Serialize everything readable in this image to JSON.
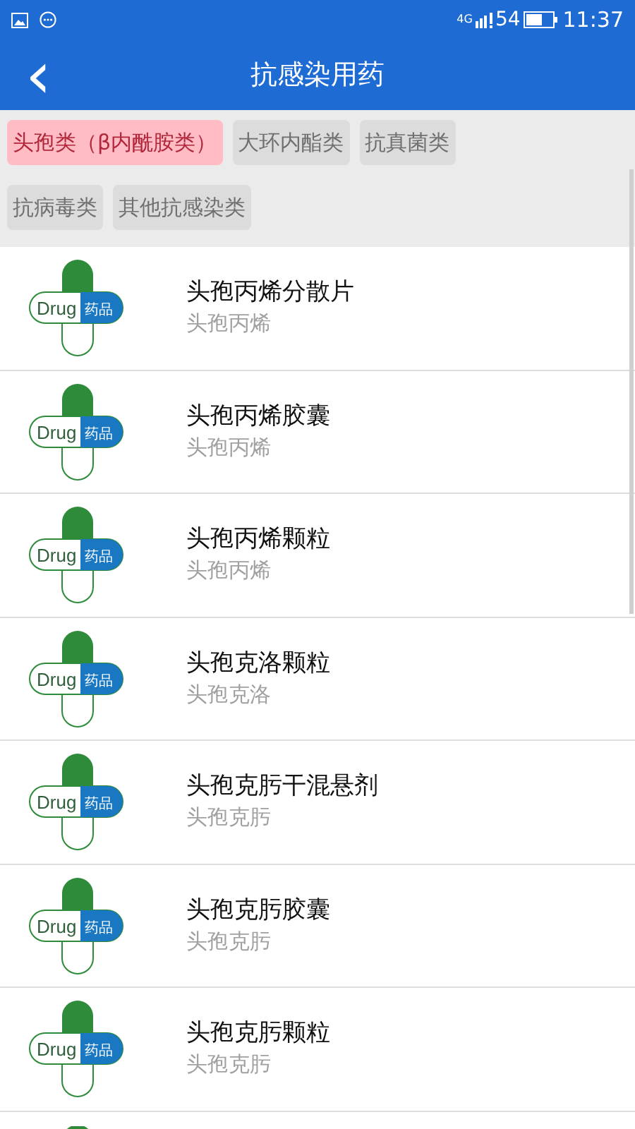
{
  "status_bar": {
    "network": "4G",
    "battery": "54",
    "time": "11:37"
  },
  "header": {
    "back": "‹",
    "title": "抗感染用药"
  },
  "categories": [
    {
      "label": "头孢类（β内酰胺类）",
      "selected": true
    },
    {
      "label": "大环内酯类",
      "selected": false
    },
    {
      "label": "抗真菌类",
      "selected": false
    },
    {
      "label": "抗病毒类",
      "selected": false
    },
    {
      "label": "其他抗感染类",
      "selected": false
    }
  ],
  "drugs": [
    {
      "name": "头孢丙烯分散片",
      "generic": "头孢丙烯",
      "logo_en": "Drug",
      "logo_cn": "药品"
    },
    {
      "name": "头孢丙烯胶囊",
      "generic": "头孢丙烯",
      "logo_en": "Drug",
      "logo_cn": "药品"
    },
    {
      "name": "头孢丙烯颗粒",
      "generic": "头孢丙烯",
      "logo_en": "Drug",
      "logo_cn": "药品"
    },
    {
      "name": "头孢克洛颗粒",
      "generic": "头孢克洛",
      "logo_en": "Drug",
      "logo_cn": "药品"
    },
    {
      "name": "头孢克肟干混悬剂",
      "generic": "头孢克肟",
      "logo_en": "Drug",
      "logo_cn": "药品"
    },
    {
      "name": "头孢克肟胶囊",
      "generic": "头孢克肟",
      "logo_en": "Drug",
      "logo_cn": "药品"
    },
    {
      "name": "头孢克肟颗粒",
      "generic": "头孢克肟",
      "logo_en": "Drug",
      "logo_cn": "药品"
    }
  ]
}
